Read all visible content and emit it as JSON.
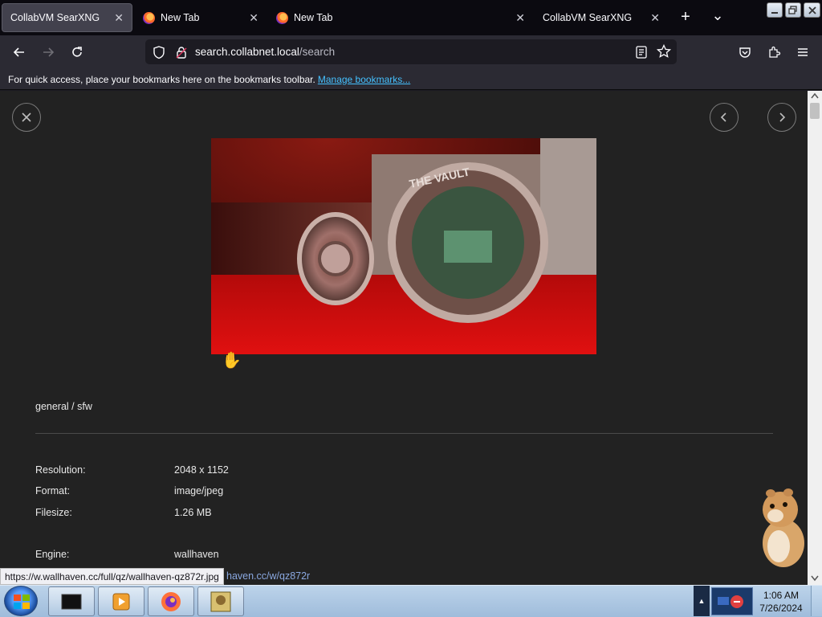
{
  "tabs": [
    {
      "label": "CollabVM SearXNG",
      "active": true
    },
    {
      "label": "New Tab",
      "active": false
    },
    {
      "label": "New Tab",
      "active": false
    },
    {
      "label": "CollabVM SearXNG",
      "active": false
    }
  ],
  "tab_close_glyph": "✕",
  "new_tab_glyph": "+",
  "list_tabs_glyph": "⌄",
  "url": {
    "host": "search.collabnet.local",
    "path": "/search"
  },
  "bookmarks": {
    "message": "For quick access, place your bookmarks here on the bookmarks toolbar.",
    "link": "Manage bookmarks..."
  },
  "detail": {
    "category": "general / sfw",
    "rows": [
      {
        "label": "Resolution:",
        "value": "2048 x 1152"
      },
      {
        "label": "Format:",
        "value": "image/jpeg"
      },
      {
        "label": "Filesize:",
        "value": "1.26 MB"
      },
      {
        "label": "Engine:",
        "value": "wallhaven"
      }
    ],
    "source_link": "haven.cc/w/qz872r"
  },
  "status_url": "https://w.wallhaven.cc/full/qz/wallhaven-qz872r.jpg",
  "clock": {
    "time": "1:06 AM",
    "date": "7/26/2024"
  },
  "colors": {
    "link": "#45c1ff",
    "page_bg": "#222222",
    "tab_bg": "#0b0a10",
    "toolbar_bg": "#2b2a33"
  },
  "icons": [
    "close-icon",
    "prev-arrow-icon",
    "next-arrow-icon",
    "shield-icon",
    "lock-icon",
    "reader-icon",
    "star-icon",
    "pocket-icon",
    "extensions-icon",
    "menu-icon"
  ]
}
